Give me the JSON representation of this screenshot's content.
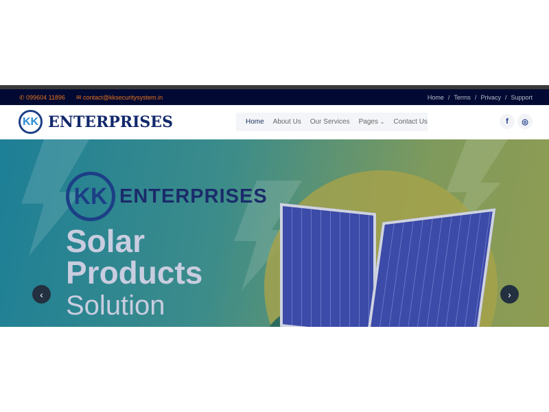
{
  "topbar": {
    "phone": "099604 11896",
    "email": "contact@kksecuritysystem.in",
    "links": [
      "Home",
      "Terms",
      "Privacy",
      "Support"
    ],
    "separator": "/"
  },
  "brand": {
    "mark": "KK",
    "name": "ENTERPRISES"
  },
  "nav": {
    "items": [
      "Home",
      "About Us",
      "Our Services",
      "Pages",
      "Contact Us"
    ]
  },
  "social": {
    "facebook": "f",
    "instagram": "◎"
  },
  "hero": {
    "brand_mark": "KK",
    "brand_name": "ENTERPRISES",
    "line1": "Solar",
    "line2": "Products",
    "line3": "Solution",
    "prev": "‹",
    "next": "›"
  }
}
